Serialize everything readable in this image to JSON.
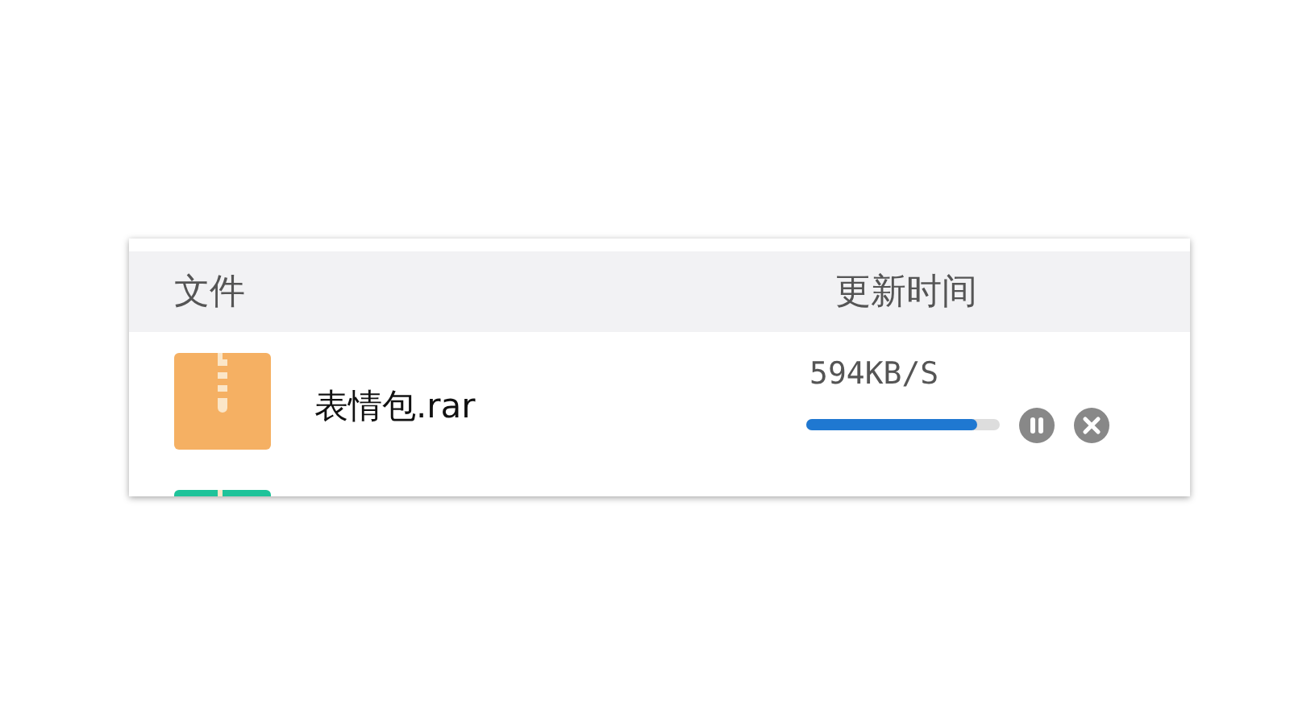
{
  "table": {
    "columns": [
      {
        "label": "文件"
      },
      {
        "label": "更新时间"
      }
    ],
    "rows": [
      {
        "name": "表情包.rar",
        "color": "#f5b063",
        "speed": "594KB/S",
        "level": 0.88
      },
      {
        "color": "#1fc39a"
      }
    ]
  }
}
